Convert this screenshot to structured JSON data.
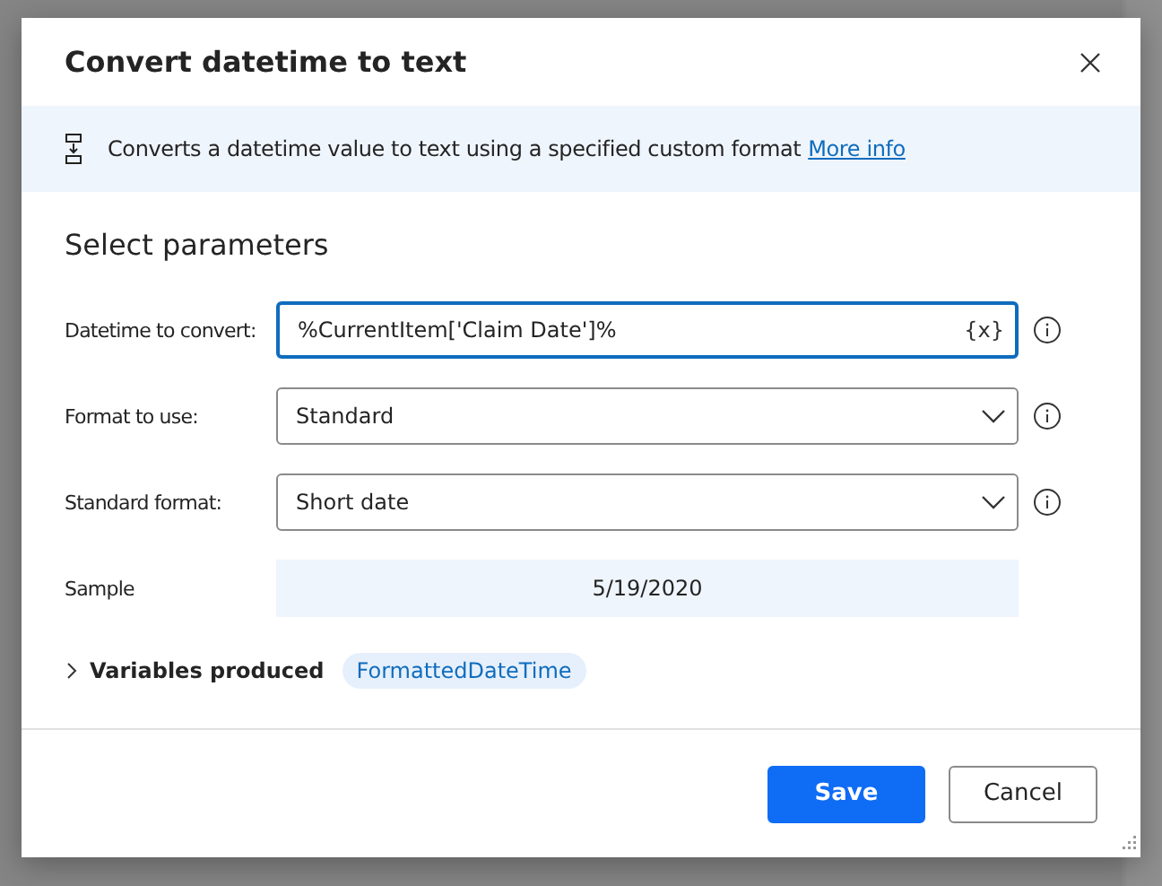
{
  "dialog": {
    "title": "Convert datetime to text",
    "description": "Converts a datetime value to text using a specified custom format",
    "more_info": "More info",
    "section": "Select parameters",
    "parameters": [
      {
        "kind": "text",
        "label": "Datetime to convert:",
        "value": "%CurrentItem['Claim Date']%",
        "variable_button": "{x}",
        "focused": true
      },
      {
        "kind": "dropdown",
        "label": "Format to use:",
        "value": "Standard",
        "focused": false
      },
      {
        "kind": "dropdown",
        "label": "Standard format:",
        "value": "Short date",
        "focused": false
      },
      {
        "kind": "sample",
        "label": "Sample",
        "value": "5/19/2020"
      }
    ],
    "variables": {
      "label": "Variables produced",
      "expanded": false,
      "items": [
        "FormattedDateTime"
      ]
    },
    "buttons": [
      {
        "label": "Save",
        "primary": true
      },
      {
        "label": "Cancel",
        "primary": false
      }
    ]
  }
}
